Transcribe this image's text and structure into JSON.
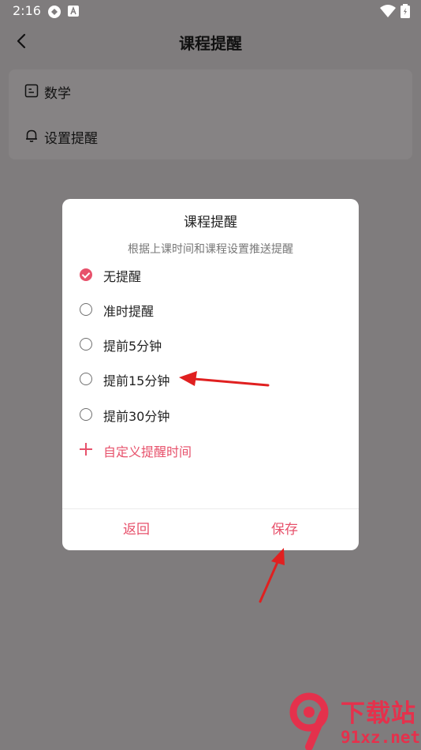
{
  "status_bar": {
    "time": "2:16"
  },
  "header": {
    "title": "课程提醒"
  },
  "settings": {
    "subject_label": "数学",
    "reminder_label": "设置提醒"
  },
  "dialog": {
    "title": "课程提醒",
    "subtitle": "根据上课时间和课程设置推送提醒",
    "options": [
      {
        "label": "无提醒",
        "selected": true
      },
      {
        "label": "准时提醒",
        "selected": false
      },
      {
        "label": "提前5分钟",
        "selected": false
      },
      {
        "label": "提前15分钟",
        "selected": false
      },
      {
        "label": "提前30分钟",
        "selected": false
      }
    ],
    "custom_label": "自定义提醒时间",
    "back_label": "返回",
    "save_label": "保存"
  },
  "watermark": {
    "top": "下载站",
    "bottom": "91xz.net"
  },
  "colors": {
    "accent": "#e7516b",
    "overlay": "#7f7c7d",
    "annotation_arrow": "#e02020"
  }
}
